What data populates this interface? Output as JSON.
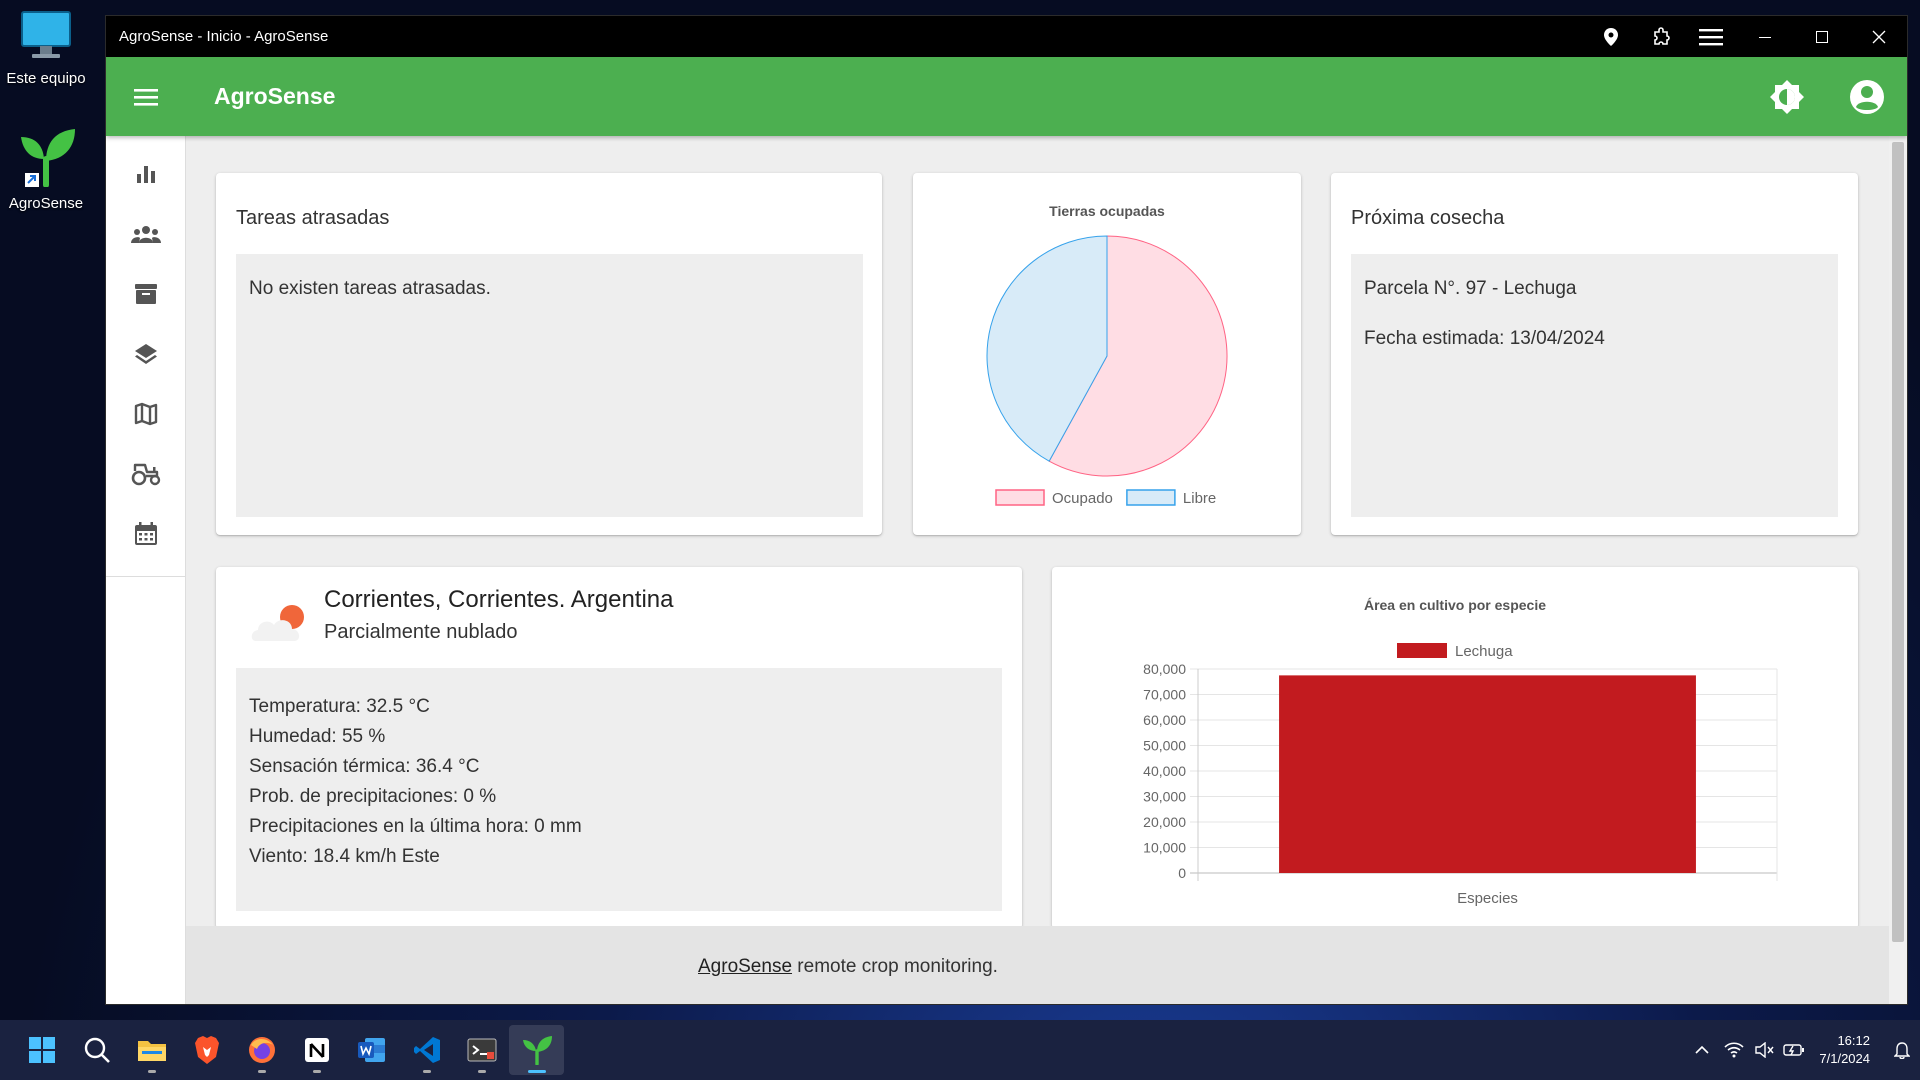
{
  "desktop": {
    "icons": [
      {
        "label": "Este equipo",
        "icon": "computer-icon"
      },
      {
        "label": "AgroSense",
        "icon": "sprout-icon"
      }
    ]
  },
  "window": {
    "title": "AgroSense - Inicio - AgroSense",
    "titlebar_icons": [
      "location-pin-icon",
      "extensions-icon",
      "hamburger-menu-icon"
    ]
  },
  "appbar": {
    "title": "AgroSense",
    "color": "#4caf50",
    "icons": [
      "menu-icon",
      "brightness-icon",
      "account-circle-icon"
    ]
  },
  "sidebar": {
    "items": [
      {
        "icon": "bar-chart-icon",
        "key": "dashboard"
      },
      {
        "icon": "groups-icon",
        "key": "users"
      },
      {
        "icon": "archive-icon",
        "key": "inventory"
      },
      {
        "icon": "layers-icon",
        "key": "crops"
      },
      {
        "icon": "map-icon",
        "key": "plots"
      },
      {
        "icon": "tractor-icon",
        "key": "machinery"
      },
      {
        "icon": "calendar-icon",
        "key": "calendar"
      }
    ]
  },
  "overdue_tasks": {
    "title": "Tareas atrasadas",
    "message": "No existen tareas atrasadas."
  },
  "land_chart": {
    "chart_data": {
      "type": "pie",
      "title": "Tierras ocupadas",
      "categories": [
        "Ocupado",
        "Libre"
      ],
      "values": [
        58,
        42
      ],
      "colors": {
        "Ocupado": "#ffdde4",
        "Libre": "#d8ebf8"
      },
      "border_colors": {
        "Ocupado": "#ff6384",
        "Libre": "#36a2eb"
      },
      "legend": "bottom"
    }
  },
  "next_harvest": {
    "title": "Próxima cosecha",
    "plot": "Parcela N°. 97 - Lechuga",
    "date": "Fecha estimada: 13/04/2024"
  },
  "weather": {
    "location": "Corrientes, Corrientes. Argentina",
    "condition": "Parcialmente nublado",
    "icon": "partly-cloudy-icon",
    "details": [
      "Temperatura: 32.5 °C",
      "Humedad: 55 %",
      "Sensación térmica: 36.4 °C",
      "Prob. de precipitaciones: 0 %",
      "Precipitaciones en la última hora: 0 mm",
      "Viento: 18.4 km/h Este"
    ]
  },
  "area_chart": {
    "chart_data": {
      "type": "bar",
      "title": "Área en cultivo por especie",
      "xlabel": "Especies",
      "ylabel": "",
      "categories": [
        ""
      ],
      "series": [
        {
          "name": "Lechuga",
          "values": [
            77500
          ],
          "color": "#c21b1f"
        }
      ],
      "ylim": [
        0,
        80000
      ],
      "yticks": [
        "80,000",
        "70,000",
        "60,000",
        "50,000",
        "40,000",
        "30,000",
        "20,000",
        "10,000",
        "0"
      ],
      "grid": true,
      "legend": "top"
    }
  },
  "footer": {
    "link": "AgroSense",
    "text": " remote crop monitoring."
  },
  "taskbar": {
    "apps": [
      "windows-start-icon",
      "search-icon",
      "file-explorer-icon",
      "brave-browser-icon",
      "firefox-icon",
      "notion-icon",
      "word-icon",
      "vscode-icon",
      "terminal-icon",
      "agrosense-icon"
    ],
    "active_app": "agrosense-icon",
    "time": "16:12",
    "date": "7/1/2024"
  }
}
